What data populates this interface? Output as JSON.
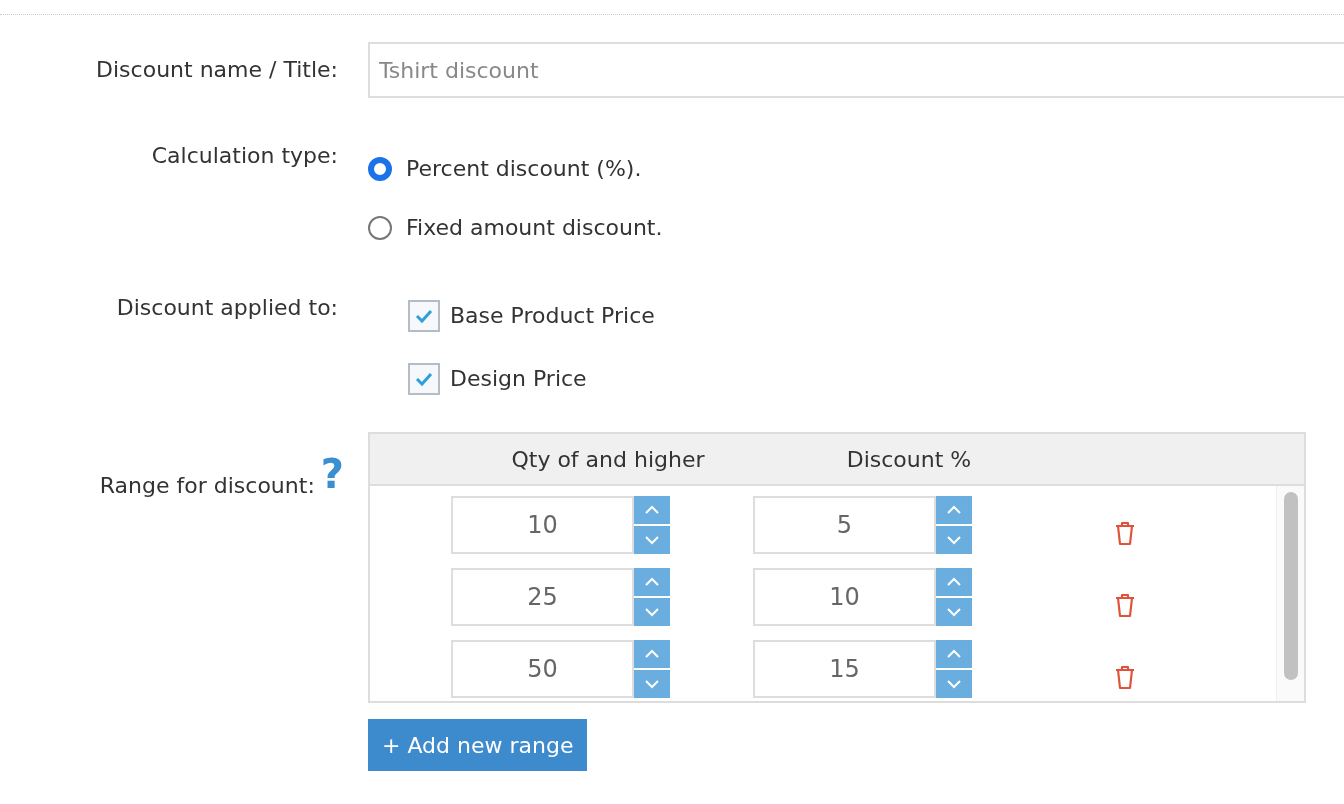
{
  "name_field": {
    "label": "Discount name / Title:",
    "placeholder": "Tshirt discount"
  },
  "calculation_type": {
    "label": "Calculation type:",
    "options": [
      {
        "label": "Percent discount (%).",
        "selected": true
      },
      {
        "label": "Fixed amount discount.",
        "selected": false
      }
    ]
  },
  "applied_to": {
    "label": "Discount applied to:",
    "options": [
      {
        "label": "Base Product Price",
        "checked": true
      },
      {
        "label": "Design Price",
        "checked": true
      }
    ]
  },
  "ranges": {
    "label": "Range for discount:",
    "help": "?",
    "columns": [
      "Qty of and higher",
      "Discount %"
    ],
    "rows": [
      {
        "qty": "10",
        "discount": "5"
      },
      {
        "qty": "25",
        "discount": "10"
      },
      {
        "qty": "50",
        "discount": "15"
      }
    ],
    "add_button": "+ Add new range"
  }
}
